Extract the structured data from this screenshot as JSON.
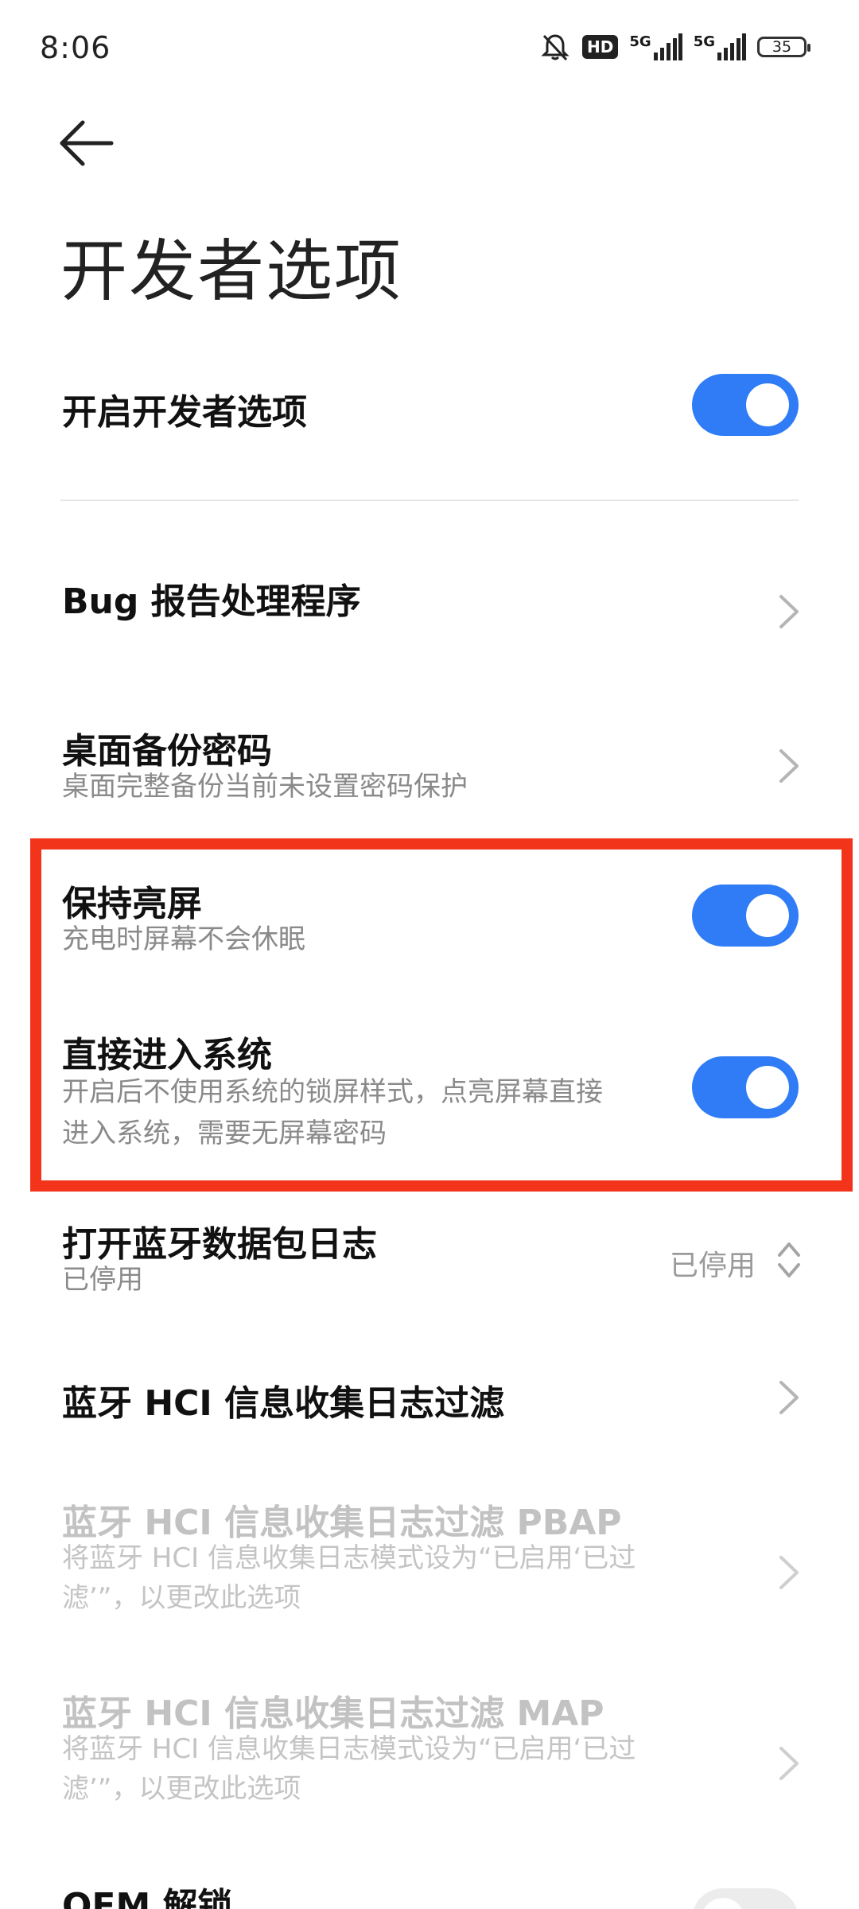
{
  "status_bar": {
    "time": "8:06",
    "hd_label": "HD",
    "network1": "5G",
    "network2": "5G",
    "battery": "35"
  },
  "header": {
    "title": "开发者选项"
  },
  "settings": {
    "enable_dev": {
      "title": "开启开发者选项",
      "toggle_on": true
    },
    "bug_report": {
      "title": "Bug 报告处理程序"
    },
    "backup_password": {
      "title": "桌面备份密码",
      "subtitle": "桌面完整备份当前未设置密码保护"
    },
    "stay_awake": {
      "title": "保持亮屏",
      "subtitle": "充电时屏幕不会休眠",
      "toggle_on": true
    },
    "direct_enter": {
      "title": "直接进入系统",
      "subtitle_line1": "开启后不使用系统的锁屏样式，点亮屏幕直接",
      "subtitle_line2": "进入系统，需要无屏幕密码",
      "toggle_on": true
    },
    "bt_snoop": {
      "title": "打开蓝牙数据包日志",
      "subtitle": "已停用",
      "value": "已停用"
    },
    "bt_hci_filter": {
      "title": "蓝牙 HCI 信息收集日志过滤"
    },
    "bt_hci_pbap": {
      "title": "蓝牙 HCI 信息收集日志过滤 PBAP",
      "subtitle_line1": "将蓝牙 HCI 信息收集日志模式设为“已启用‘已过",
      "subtitle_line2": "滤’”，以更改此选项"
    },
    "bt_hci_map": {
      "title": "蓝牙 HCI 信息收集日志过滤 MAP",
      "subtitle_line1": "将蓝牙 HCI 信息收集日志模式设为“已启用‘已过",
      "subtitle_line2": "滤’”，以更改此选项"
    },
    "oem_unlock": {
      "title": "OEM 解锁",
      "toggle_on": false
    }
  },
  "colors": {
    "accent": "#2f7cf6",
    "highlight": "#f2341a"
  }
}
